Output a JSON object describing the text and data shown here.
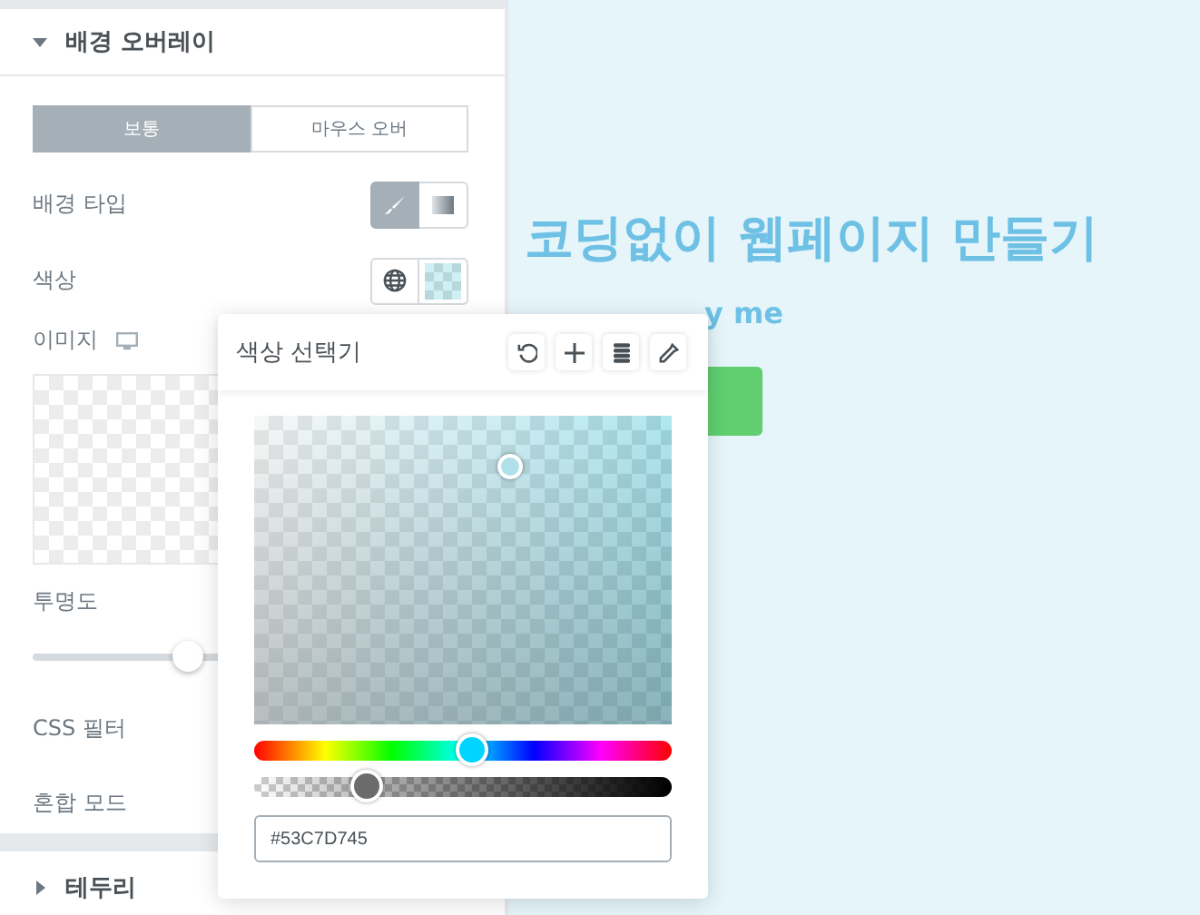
{
  "panel": {
    "section": {
      "title": "배경 오버레이",
      "expanded": true
    },
    "state_tabs": [
      {
        "label": "보통",
        "selected": true
      },
      {
        "label": "마우스 오버",
        "selected": false
      }
    ],
    "background_type": {
      "label": "배경 타입",
      "options": [
        {
          "kind": "brush",
          "selected": true
        },
        {
          "kind": "gradient",
          "selected": false
        }
      ]
    },
    "color": {
      "label": "색상"
    },
    "image": {
      "label": "이미지"
    },
    "opacity": {
      "label": "투명도",
      "level": 0.36
    },
    "css_filter": {
      "label": "CSS 필터"
    },
    "blend_mode": {
      "label": "혼합 모드"
    },
    "next_section": {
      "title": "테두리",
      "expanded": false
    }
  },
  "color_picker": {
    "title": "색상 선택기",
    "hue": {
      "level": 0.52
    },
    "alpha": {
      "level": 0.27
    },
    "value": "#53C7D745"
  },
  "canvas": {
    "heading": "코딩없이 웹페이지 만들기",
    "subtitle": "y me"
  }
}
